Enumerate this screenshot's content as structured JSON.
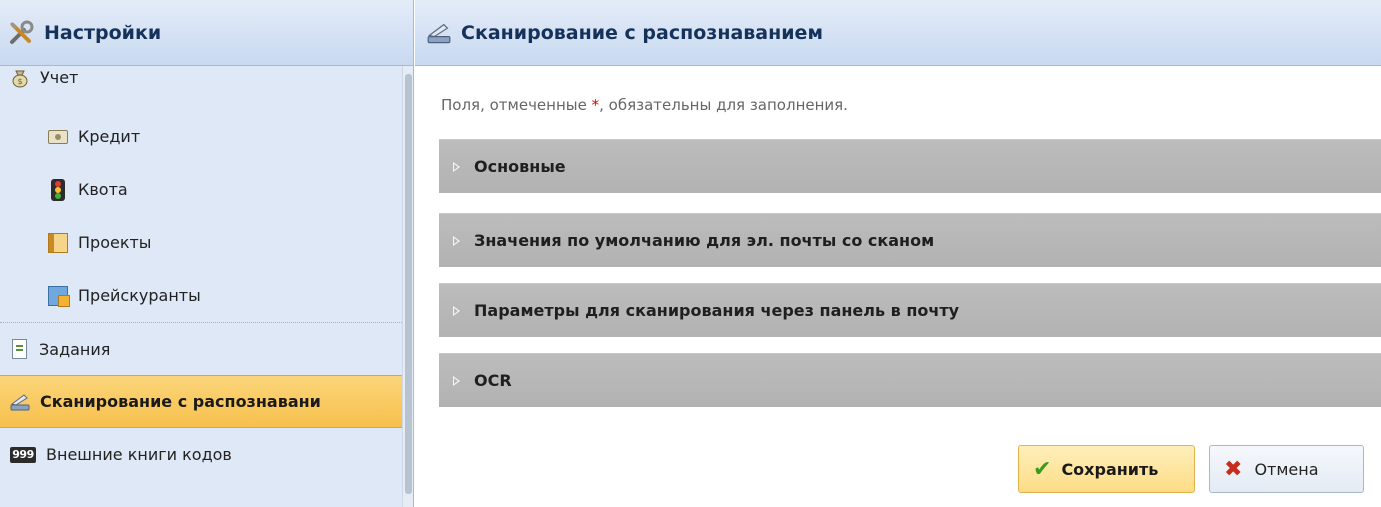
{
  "sidebar": {
    "title": "Настройки",
    "items": [
      {
        "label": "Учет",
        "icon": "money-bag-icon",
        "level": "root"
      },
      {
        "label": "Кредит",
        "icon": "banknote-icon",
        "level": "child"
      },
      {
        "label": "Квота",
        "icon": "traffic-light-icon",
        "level": "child"
      },
      {
        "label": "Проекты",
        "icon": "book-icon",
        "level": "child"
      },
      {
        "label": "Прейскуранты",
        "icon": "price-list-icon",
        "level": "child"
      },
      {
        "label": "Задания",
        "icon": "document-icon",
        "level": "root"
      },
      {
        "label": "Сканирование с распознавани",
        "icon": "scanner-icon",
        "level": "root",
        "selected": true
      },
      {
        "label": "Внешние книги кодов",
        "icon": "code-book-999-icon",
        "level": "root"
      }
    ]
  },
  "main": {
    "title": "Сканирование с распознаванием",
    "hint_before": "Поля, отмеченные ",
    "hint_mark": "*",
    "hint_after": ", обязательны для заполнения.",
    "sections": [
      {
        "label": "Основные"
      },
      {
        "label": "Значения по умолчанию для эл. почты со сканом"
      },
      {
        "label": "Параметры для сканирования через панель в почту"
      },
      {
        "label": "OCR"
      }
    ],
    "save_label": "Сохранить",
    "cancel_label": "Отмена"
  },
  "colors": {
    "header_text": "#15325a",
    "selected_bg": "#f7c04d",
    "section_bg": "#b6b6b6",
    "save_bg": "#fddc85",
    "required_mark": "#dd0000"
  }
}
